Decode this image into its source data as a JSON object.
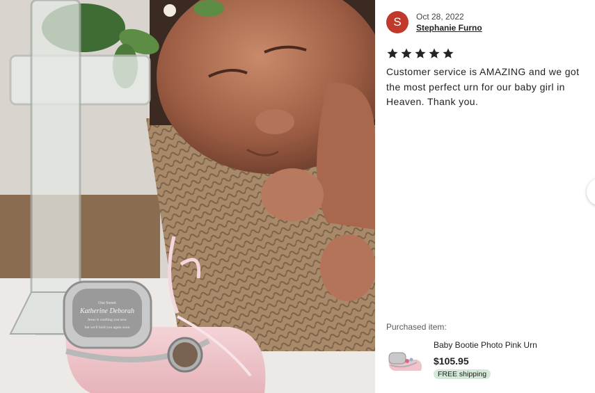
{
  "review": {
    "avatar_initial": "S",
    "date": "Oct 28, 2022",
    "reviewer_name": "Stephanie Furno",
    "rating": 5,
    "text": "Customer service is AMAZING and we got the most perfect urn for our baby girl in Heaven. Thank you."
  },
  "purchase": {
    "label": "Purchased item:",
    "item_title": "Baby Bootie Photo Pink Urn",
    "price": "$105.95",
    "shipping_badge": "FREE shipping"
  },
  "photo": {
    "urn_engraving": [
      "Our Sweet",
      "Katherine Deborah",
      "Jesus is cradling you now",
      "but we'll hold you again soon"
    ]
  },
  "colors": {
    "avatar": "#c0392b",
    "shipping_badge_bg": "#d4e9d7",
    "star": "#222222"
  }
}
